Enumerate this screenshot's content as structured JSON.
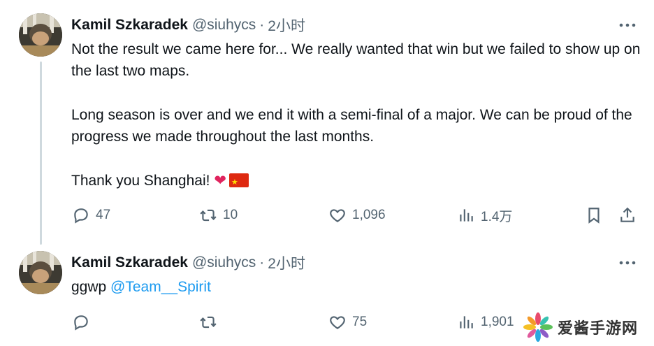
{
  "tweets": [
    {
      "name": "Kamil Szkaradek",
      "handle": "@siuhycs",
      "separator": "·",
      "time": "2小时",
      "paragraphs": [
        "Not the result we came here for... We really wanted that win but we failed to show up on the last two maps.",
        "Long season is over and we end it with a semi-final of a major. We can be proud of the progress we made throughout the last months.",
        "Thank you Shanghai!"
      ],
      "emoji": [
        "red-heart",
        "china-flag"
      ],
      "heart_glyph": "❤",
      "actions": {
        "replies": "47",
        "retweets": "10",
        "likes": "1,096",
        "views": "1.4万"
      }
    },
    {
      "name": "Kamil Szkaradek",
      "handle": "@siuhycs",
      "separator": "·",
      "time": "2小时",
      "text_prefix": "ggwp ",
      "mention": "@Team__Spirit",
      "actions": {
        "replies": "",
        "retweets": "",
        "likes": "75",
        "views": "1,901"
      }
    }
  ],
  "watermark": {
    "text": "爱酱手游网"
  },
  "colors": {
    "text": "#0f1419",
    "secondary": "#536471",
    "link": "#1d9bf0",
    "thread_line": "#cfd9de"
  }
}
